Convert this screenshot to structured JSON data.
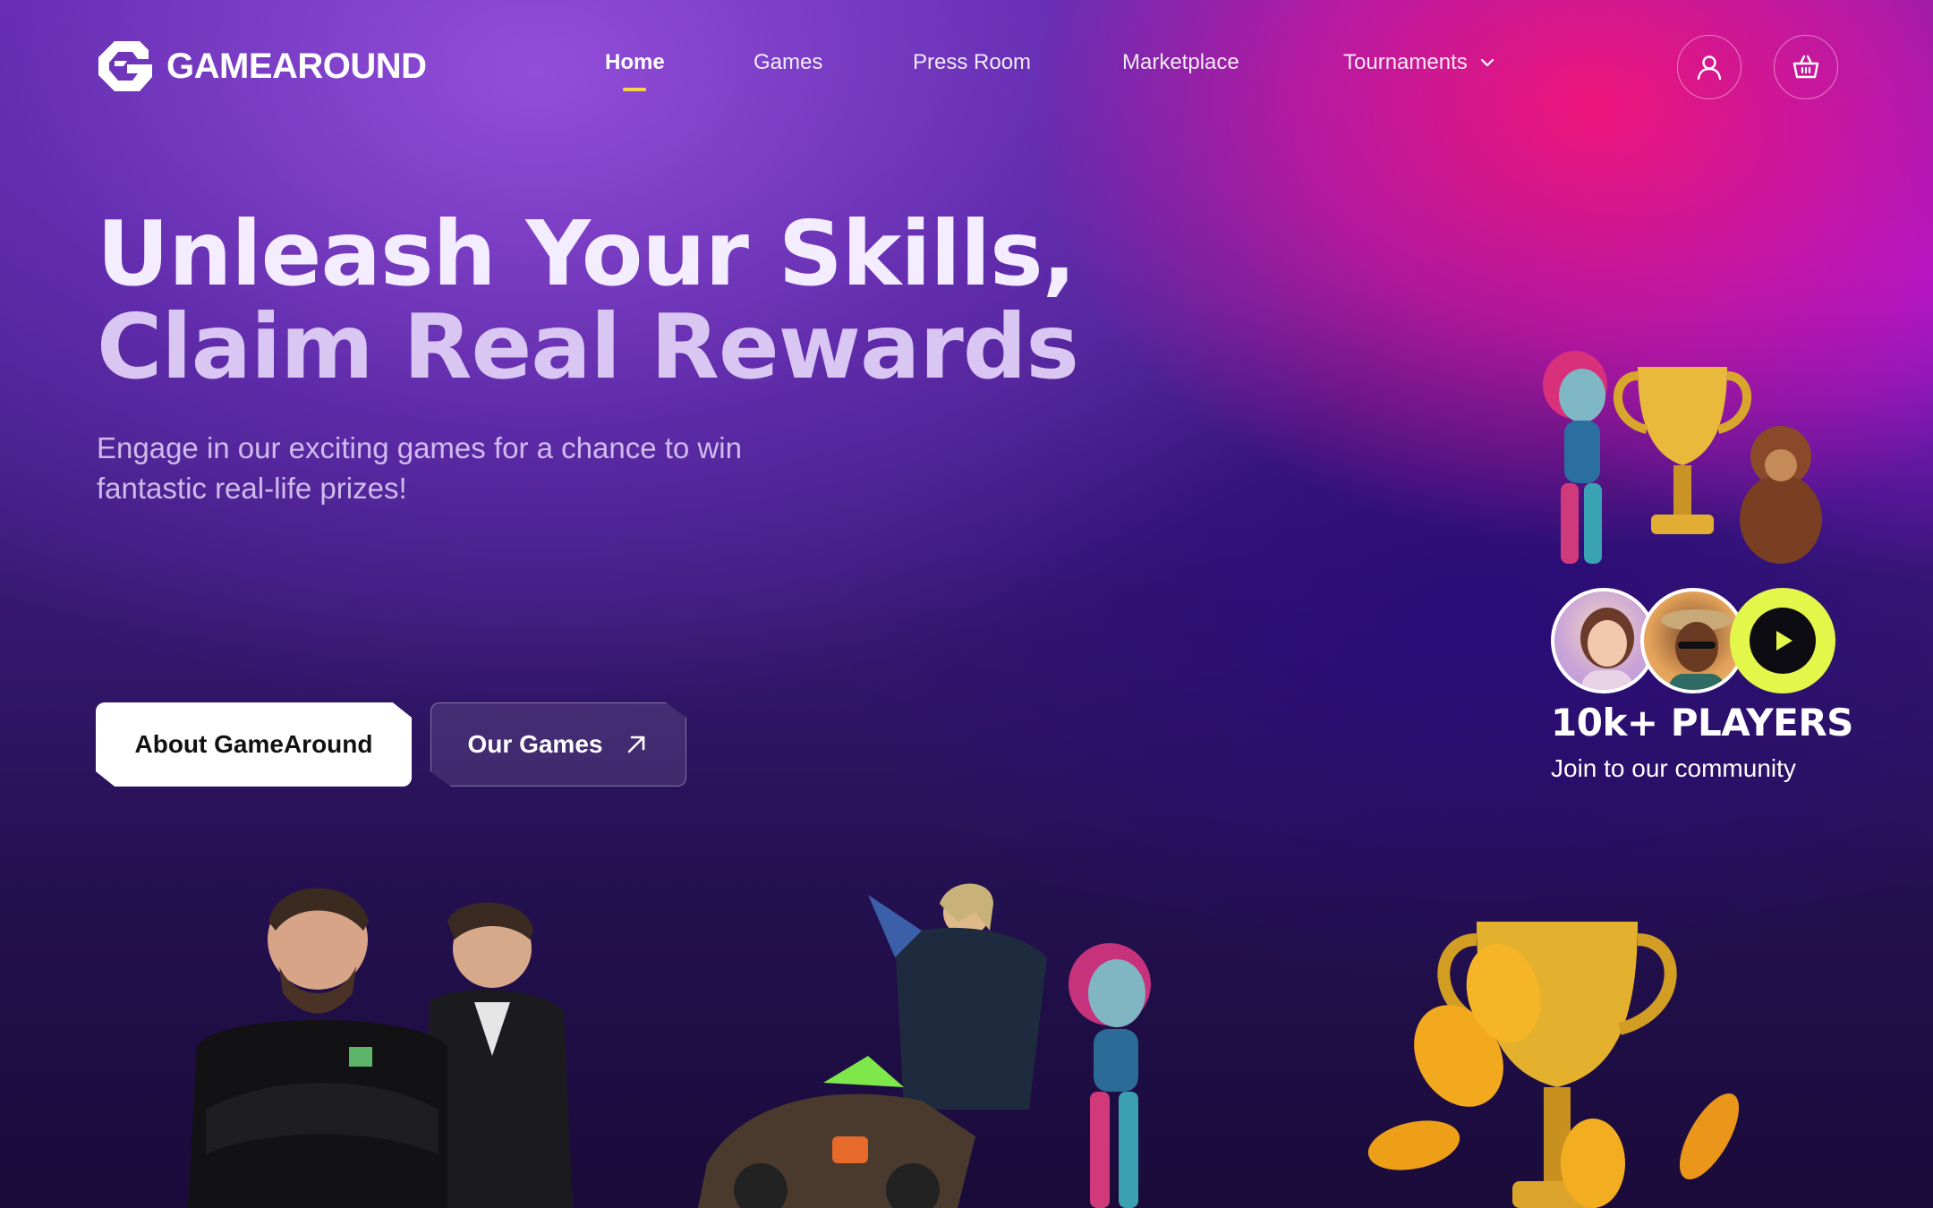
{
  "brand": {
    "name": "GAMEAROUND"
  },
  "nav": {
    "links": [
      {
        "label": "Home",
        "active": true
      },
      {
        "label": "Games"
      },
      {
        "label": "Press Room"
      },
      {
        "label": "Marketplace"
      },
      {
        "label": "Tournaments",
        "has_dropdown": true
      }
    ],
    "icons": [
      "user-icon",
      "basket-icon"
    ]
  },
  "hero": {
    "headline_line1": "Unleash Your Skills,",
    "headline_line2": "Claim Real Rewards",
    "subtitle": "Engage in our exciting games for a chance to win fantastic real-life prizes!",
    "primary_button": "About GameAround",
    "secondary_button": "Our Games"
  },
  "community": {
    "count": "10k+ PLAYERS",
    "subtitle": "Join to our community"
  },
  "colors": {
    "accent_yellow": "#f5d24a",
    "play_button": "#e3f64a",
    "pink": "#f0147a",
    "purple": "#6a32b8"
  }
}
